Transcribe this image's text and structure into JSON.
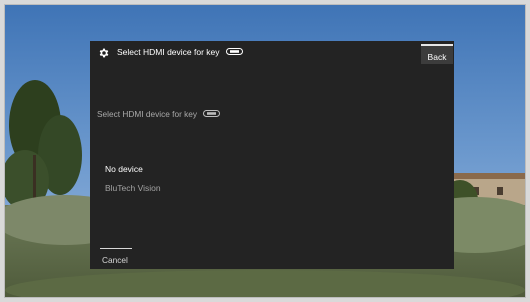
{
  "dialog": {
    "title": "Select HDMI device for key",
    "back_label": "Back",
    "prompt": "Select HDMI device for key",
    "key_icon": "hdmi-key-icon",
    "options": [
      {
        "label": "No device",
        "selected": true
      },
      {
        "label": "BluTech Vision",
        "selected": false
      }
    ],
    "cancel_label": "Cancel"
  },
  "colors": {
    "dialog_bg": "#232323",
    "accent": "#ffffff",
    "muted_text": "#a9a9a9"
  }
}
